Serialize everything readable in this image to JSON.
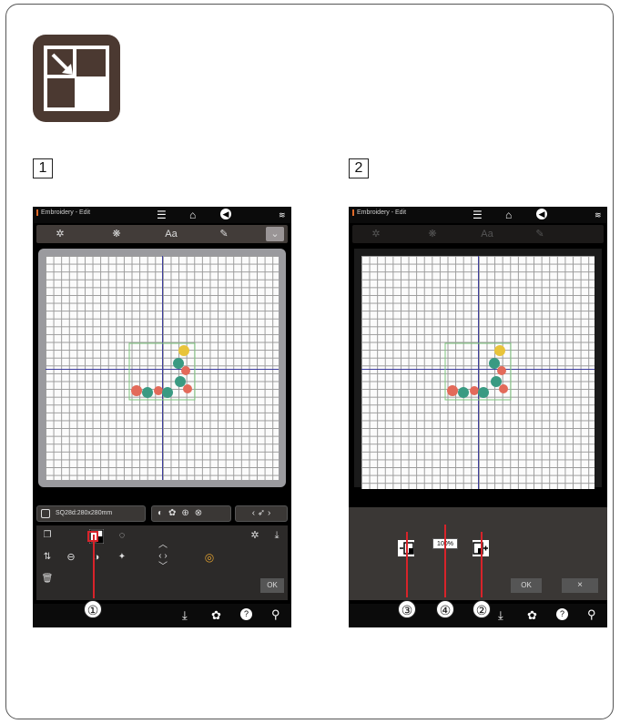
{
  "steps": [
    "1",
    "2"
  ],
  "screen": {
    "header_title": "Embroidery - Edit",
    "tabs": [
      "Aa"
    ],
    "hoop_label": "SQ28d:280x280mm",
    "ok_label": "OK",
    "cancel_label": "×"
  },
  "zoom_panel": {
    "percent": "100%",
    "ok_label": "OK",
    "cancel_label": "×"
  },
  "callouts": [
    "①",
    "③",
    "④",
    "②"
  ],
  "icons": {
    "badge": "resize-icon",
    "menu": "hamburger-icon",
    "home": "home-icon",
    "back": "back-icon",
    "wifi": "wifi-icon",
    "settings": "gear-icon",
    "help": "help-icon",
    "tools": "wrench-icon"
  },
  "colors": {
    "badge_bg": "#4b3931",
    "callout_line": "#d8232a",
    "axis": "#3d3d9e",
    "frame_border": "#9a9a9e"
  }
}
